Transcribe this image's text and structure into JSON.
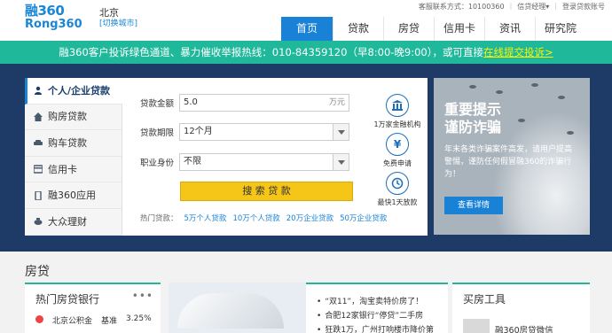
{
  "header": {
    "logo_cn": "融360",
    "logo_en": "Rong360",
    "city": "北京",
    "switch_city": "[切换城市]",
    "toplinks": [
      "客服联系方式：10100360",
      "信贷经理▾",
      "登录贷款账号"
    ],
    "nav": [
      "首页",
      "贷款",
      "房贷",
      "信用卡",
      "资讯",
      "研究院"
    ],
    "nav_active_index": 0
  },
  "banner": {
    "text": "融360客户投诉绿色通道、暴力催收举报热线：010-84359120（早8:00-晚9:00），或可直接",
    "link": "在线提交投诉>"
  },
  "sidebar": {
    "items": [
      {
        "label": "个人/企业贷款",
        "icon": "user-icon"
      },
      {
        "label": "购房贷款",
        "icon": "house-icon"
      },
      {
        "label": "购车贷款",
        "icon": "car-icon"
      },
      {
        "label": "信用卡",
        "icon": "card-icon"
      },
      {
        "label": "融360应用",
        "icon": "phone-icon"
      },
      {
        "label": "大众理财",
        "icon": "piggy-icon"
      }
    ],
    "active_index": 0
  },
  "loan_form": {
    "amount_label": "贷款金额",
    "amount_value": "5.0",
    "amount_unit": "万元",
    "term_label": "贷款期限",
    "term_value": "12个月",
    "job_label": "职业身份",
    "job_value": "不限",
    "submit": "搜 索 贷 款",
    "hot_label": "热门贷款：",
    "hot_links": [
      "5万个人贷款",
      "10万个人贷款",
      "20万企业贷款",
      "50万企业贷款"
    ]
  },
  "features": [
    {
      "label": "1万家金融机构",
      "icon": "bank-icon",
      "glyph": "🏛"
    },
    {
      "label": "免费申请",
      "icon": "yen-icon",
      "glyph": "¥"
    },
    {
      "label": "最快1天放款",
      "icon": "clock-icon",
      "glyph": "⏱"
    }
  ],
  "notice": {
    "title_line1": "重要提示",
    "title_line2": "谨防诈骗",
    "desc": "年末各类诈骗案件高发，请用户提高警惕，谨防任何假冒融360的诈骗行为！",
    "button": "查看详情"
  },
  "section": {
    "title": "房贷",
    "card1_title": "热门房贷银行",
    "card1_more": "•••",
    "card1_row": [
      "北京公积金",
      "基准",
      "3.25%"
    ],
    "news": [
      "“双11”，淘宝卖特价房了！",
      "合肥12家银行“停贷”二手房",
      "狂跌1万，广州打响楼市降价第"
    ],
    "card3_title": "买房工具",
    "card3_item": "融360房贷微信"
  },
  "colors": {
    "brand_blue": "#1a82d6",
    "banner_green": "#1fb89b",
    "hero_bg": "#1d3b66",
    "button_yellow": "#f5c518"
  }
}
